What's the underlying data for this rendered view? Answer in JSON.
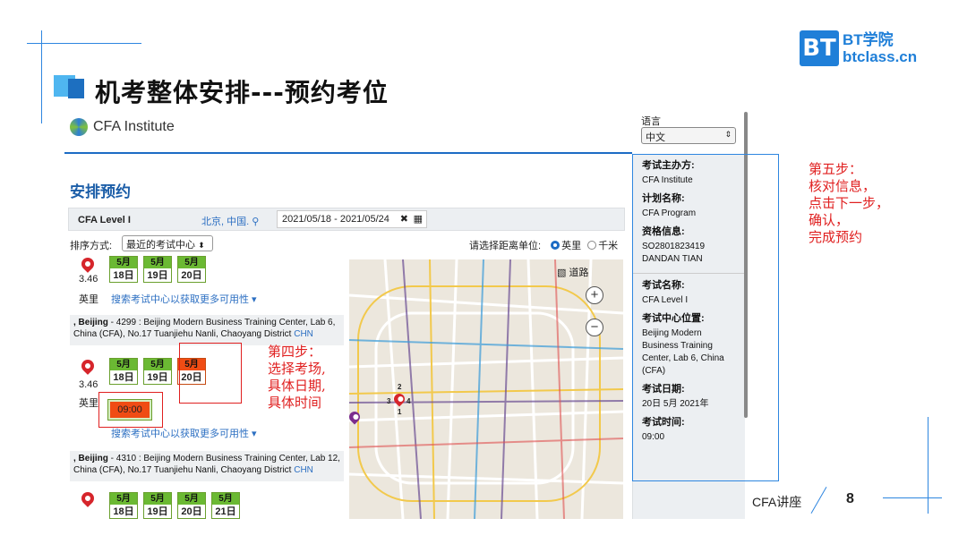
{
  "slide": {
    "title": "机考整体安排---预约考位",
    "logo": {
      "mark": "BT",
      "line1": "BT学院",
      "line2": "btclass.cn"
    },
    "footer_label": "CFA讲座",
    "page_number": "8",
    "colors": {
      "accent": "#2e86e0",
      "annotation": "#e02020"
    }
  },
  "app": {
    "brand": "CFA Institute",
    "language": {
      "label": "语言",
      "selected": "中文"
    },
    "page_title": "安排预约",
    "search": {
      "level": "CFA Level I",
      "location": "北京, 中国.",
      "date_range": "2021/05/18 - 2021/05/24"
    },
    "sort": {
      "label": "排序方式:",
      "selected": "最近的考试中心"
    },
    "distance": {
      "label": "请选择距离单位:",
      "option1": "英里",
      "option2": "千米",
      "selected": "英里"
    },
    "more_link": "搜索考试中心以获取更多可用性",
    "unit": "英里",
    "centers": [
      {
        "index": "3",
        "distance": "3.46",
        "dates": [
          {
            "m": "5月",
            "d": "18日"
          },
          {
            "m": "5月",
            "d": "19日"
          },
          {
            "m": "5月",
            "d": "20日"
          }
        ]
      },
      {
        "index": "",
        "city": ", Beijing",
        "text": " - 4299 : Beijing Modern Business Training Center, Lab 6, China (CFA), No.17 Tuanjiehu Nanli, Chaoyang District ",
        "country": "CHN",
        "distance": "3.46",
        "dates": [
          {
            "m": "5月",
            "d": "18日"
          },
          {
            "m": "5月",
            "d": "19日"
          },
          {
            "m": "5月",
            "d": "20日"
          }
        ],
        "time": "09:00"
      },
      {
        "index": "5",
        "city": ", Beijing",
        "text": " - 4310 : Beijing Modern Business Training Center, Lab 12, China (CFA), No.17 Tuanjiehu Nanli, Chaoyang District ",
        "country": "CHN",
        "dates": [
          {
            "m": "5月",
            "d": "18日"
          },
          {
            "m": "5月",
            "d": "19日"
          },
          {
            "m": "5月",
            "d": "20日"
          },
          {
            "m": "5月",
            "d": "21日"
          }
        ]
      }
    ],
    "map": {
      "road_label": "道路",
      "zoom_in": "+",
      "zoom_out": "−",
      "markers": [
        "2",
        "3",
        "4",
        "1"
      ]
    },
    "summary": [
      {
        "label": "考试主办方:",
        "value": "CFA Institute"
      },
      {
        "label": "计划名称:",
        "value": "CFA Program"
      },
      {
        "label": "资格信息:",
        "value": "SO2801823419 DANDAN TIAN"
      },
      {
        "label": "考试名称:",
        "value": "CFA Level I"
      },
      {
        "label": "考试中心位置:",
        "value": "Beijing Modern Business Training Center, Lab 6, China (CFA)"
      },
      {
        "label": "考试日期:",
        "value": "20日 5月 2021年"
      },
      {
        "label": "考试时间:",
        "value": "09:00"
      }
    ]
  },
  "annotations": {
    "step4": [
      "第四步：",
      "选择考场,",
      "具体日期,",
      "具体时间"
    ],
    "step5": [
      "第五步：",
      "核对信息，",
      "点击下一步，",
      "确认，",
      "完成预约"
    ]
  }
}
